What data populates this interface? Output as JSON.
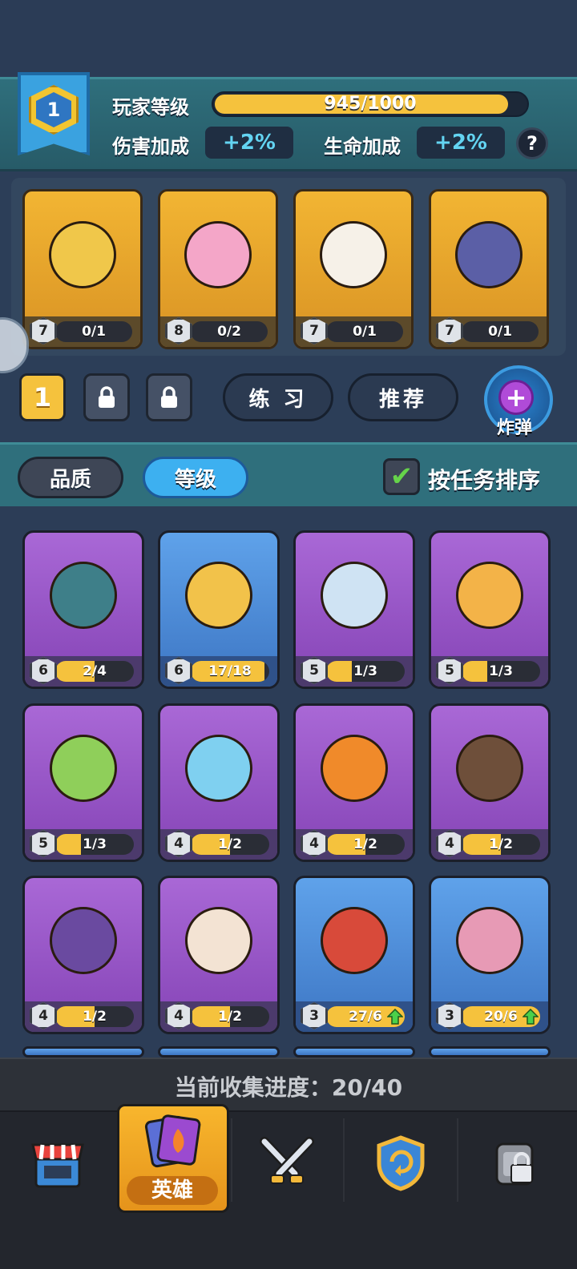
{
  "player": {
    "level": "1",
    "level_label": "玩家等级",
    "xp_text": "945/1000",
    "xp_fraction": 0.945,
    "damage_label": "伤害加成",
    "damage_value": "+2%",
    "hp_label": "生命加成",
    "hp_value": "+2%",
    "help_text": "?"
  },
  "team": [
    {
      "level": "7",
      "progress": "0/1",
      "fraction": 0.0,
      "art": "knight-hero",
      "color": "#f0c74a"
    },
    {
      "level": "8",
      "progress": "0/2",
      "fraction": 0.0,
      "art": "pink-ninja-hero",
      "color": "#f4a6c8"
    },
    {
      "level": "7",
      "progress": "0/1",
      "fraction": 0.0,
      "art": "cat-priest-hero",
      "color": "#f6f1e8"
    },
    {
      "level": "7",
      "progress": "0/1",
      "fraction": 0.0,
      "art": "shadow-mage-hero",
      "color": "#5b5fa6"
    }
  ],
  "deck": {
    "active": "1",
    "practice": "练 习",
    "recommend": "推荐",
    "bomb_label": "炸弹",
    "bomb_plus": "+"
  },
  "sort": {
    "quality": "品质",
    "level": "等级",
    "by_task": "按任务排序",
    "check": "✔"
  },
  "heroes": [
    {
      "level": "6",
      "progress": "2/4",
      "fraction": 0.5,
      "rarity": "epic",
      "art": "zombie-pirate-hero",
      "color": "#3e7f89",
      "upgrade": false
    },
    {
      "level": "6",
      "progress": "17/18",
      "fraction": 0.94,
      "rarity": "rare",
      "art": "gladiator-hero",
      "color": "#f2c24a",
      "upgrade": false
    },
    {
      "level": "5",
      "progress": "1/3",
      "fraction": 0.33,
      "rarity": "epic",
      "art": "yeti-hero",
      "color": "#cfe3f3",
      "upgrade": false
    },
    {
      "level": "5",
      "progress": "1/3",
      "fraction": 0.33,
      "rarity": "epic",
      "art": "tiger-pirate-hero",
      "color": "#f3b348",
      "upgrade": false
    },
    {
      "level": "5",
      "progress": "1/3",
      "fraction": 0.33,
      "rarity": "epic",
      "art": "dryad-hero",
      "color": "#8fcf5a",
      "upgrade": false
    },
    {
      "level": "4",
      "progress": "1/2",
      "fraction": 0.5,
      "rarity": "epic",
      "art": "slime-hero",
      "color": "#7fd0f0",
      "upgrade": false
    },
    {
      "level": "4",
      "progress": "1/2",
      "fraction": 0.5,
      "rarity": "epic",
      "art": "fire-spirit-hero",
      "color": "#f08a2a",
      "upgrade": false
    },
    {
      "level": "4",
      "progress": "1/2",
      "fraction": 0.5,
      "rarity": "epic",
      "art": "ronin-hero",
      "color": "#6e4f3a",
      "upgrade": false
    },
    {
      "level": "4",
      "progress": "1/2",
      "fraction": 0.5,
      "rarity": "epic",
      "art": "minotaur-hero",
      "color": "#6a4aa0",
      "upgrade": false
    },
    {
      "level": "4",
      "progress": "1/2",
      "fraction": 0.5,
      "rarity": "epic",
      "art": "ice-princess-hero",
      "color": "#f3e3d3",
      "upgrade": false
    },
    {
      "level": "3",
      "progress": "27/6",
      "fraction": 1.0,
      "rarity": "rare",
      "art": "viking-hero",
      "color": "#d84a3a",
      "upgrade": true
    },
    {
      "level": "3",
      "progress": "20/6",
      "fraction": 1.0,
      "rarity": "rare",
      "art": "bird-squad-hero",
      "color": "#e79ab5",
      "upgrade": true
    }
  ],
  "collection": {
    "text": "当前收集进度：20/40"
  },
  "nav": {
    "heroes_label": "英雄",
    "icons": [
      "shop-icon",
      "heroes-icon",
      "battle-icon",
      "clan-icon",
      "locked-icon"
    ]
  }
}
